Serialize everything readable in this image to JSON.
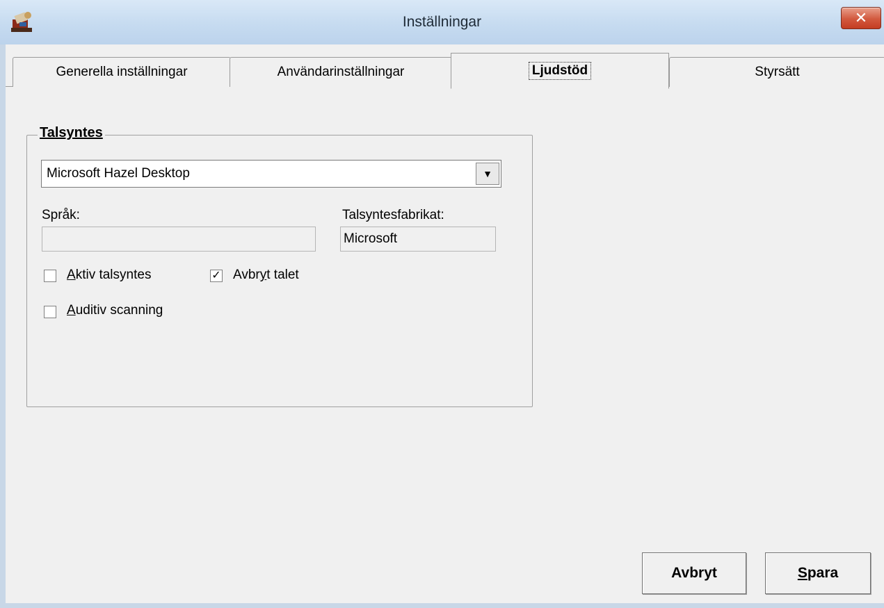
{
  "window": {
    "title": "Inställningar",
    "close_glyph": "✕"
  },
  "tabs": [
    {
      "label": "Generella inställningar",
      "active": false
    },
    {
      "label": "Användarinställningar",
      "active": false
    },
    {
      "label": "Ljudstöd",
      "active": true
    },
    {
      "label": "Styrsätt",
      "active": false
    }
  ],
  "talsyntes": {
    "group_title": "Talsyntes",
    "voice_selected": "Microsoft Hazel Desktop",
    "dropdown_glyph": "▼",
    "language_label": "Språk:",
    "language_value": "",
    "vendor_label": "Talsyntesfabrikat:",
    "vendor_value": "Microsoft",
    "checkboxes": {
      "active_tts": {
        "label_pre": "",
        "label_access": "A",
        "label_post": "ktiv talsyntes",
        "checked": false
      },
      "interrupt": {
        "label_pre": "Avbr",
        "label_access": "y",
        "label_post": "t talet",
        "checked": true
      },
      "auditory_scan": {
        "label_pre": "",
        "label_access": "A",
        "label_post": "uditiv scanning",
        "checked": false
      }
    },
    "check_glyph": "✓"
  },
  "buttons": {
    "cancel_label": "Avbryt",
    "save_access": "S",
    "save_rest": "para"
  }
}
